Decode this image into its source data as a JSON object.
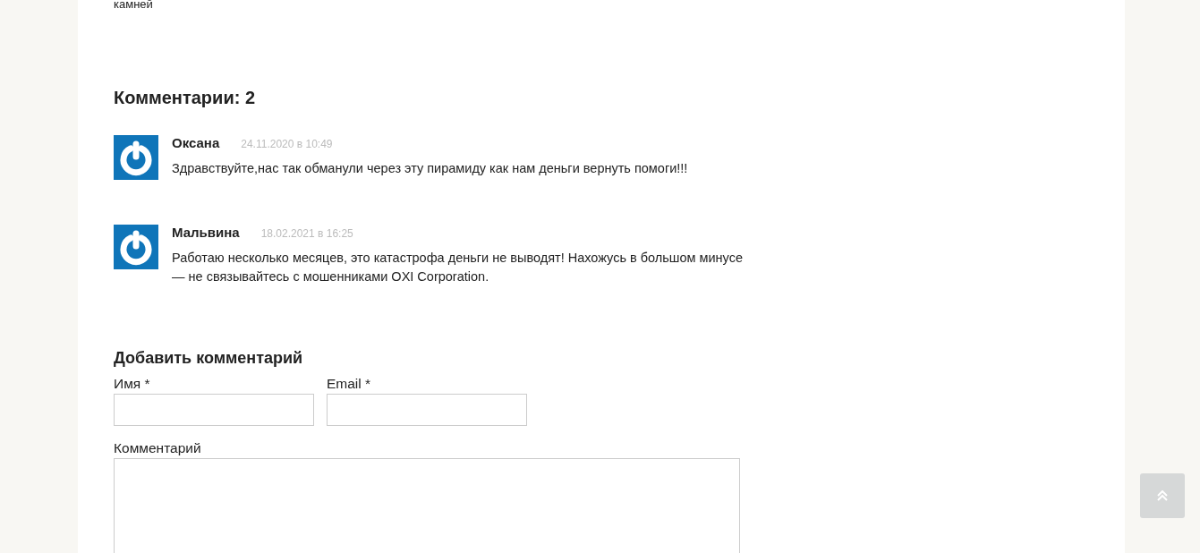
{
  "article_tail": "камней",
  "comments_heading": "Комментарии: 2",
  "comments": [
    {
      "author": "Оксана",
      "date": "24.11.2020 в 10:49",
      "text": "Здравствуйте,нас так обманули через эту пирамиду как нам деньги вернуть помоги!!!"
    },
    {
      "author": "Мальвина",
      "date": "18.02.2021 в 16:25",
      "text": "Работаю несколько месяцев, это катастрофа деньги не выводят! Нахожусь в большом минусе — не связывайтесь с мошенниками OXI Corporation."
    }
  ],
  "form": {
    "title": "Добавить комментарий",
    "name_label": "Имя *",
    "email_label": "Email *",
    "comment_label": "Комментарий"
  }
}
